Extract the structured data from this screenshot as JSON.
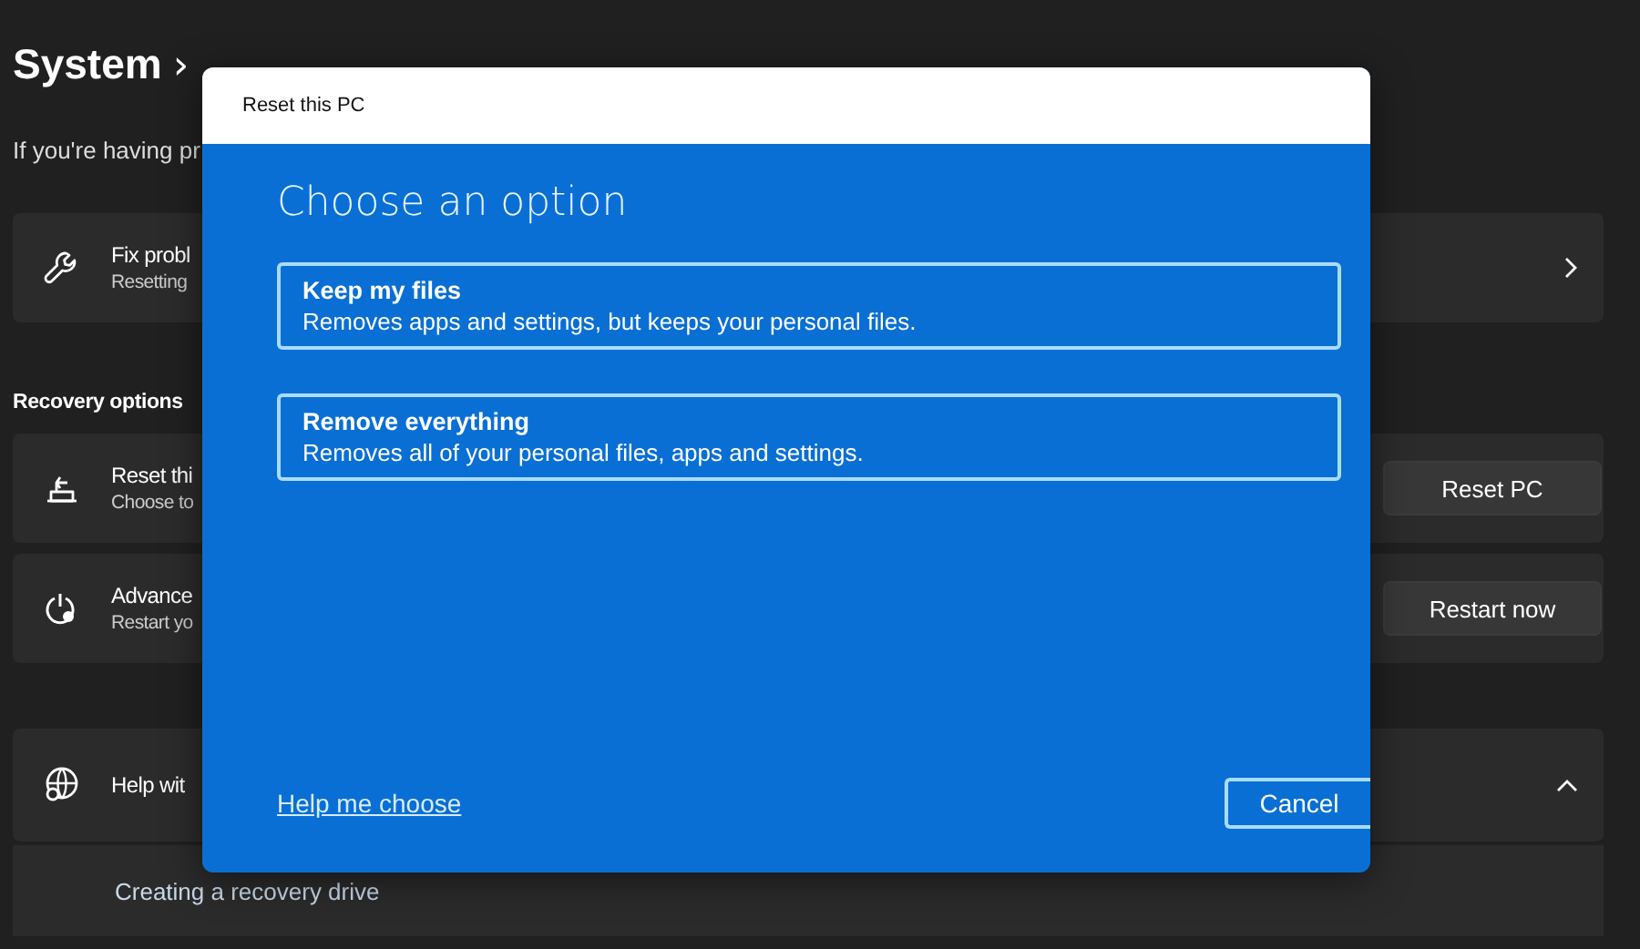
{
  "page": {
    "breadcrumb": [
      "System",
      "›"
    ],
    "intro": "If you're having pr",
    "cards": [
      {
        "kind": "link",
        "title": "Fix probl",
        "subtitle": "Resetting"
      },
      {
        "kind": "heading",
        "title": "Recovery options"
      },
      {
        "kind": "button",
        "title": "Reset thi",
        "subtitle": "Choose to",
        "button": "Reset PC"
      },
      {
        "kind": "button",
        "title": "Advance",
        "subtitle": "Restart yo",
        "button": "Restart now"
      },
      {
        "kind": "expander",
        "title": "Help wit",
        "expanded": true,
        "links": [
          "Creating a recovery drive"
        ]
      }
    ]
  },
  "dialog": {
    "title": "Reset this PC",
    "heading": "Choose an option",
    "options": [
      {
        "title": "Keep my files",
        "description": "Removes apps and settings, but keeps your personal files."
      },
      {
        "title": "Remove everything",
        "description": "Removes all of your personal files, apps and settings."
      }
    ],
    "help_link": "Help me choose",
    "cancel": "Cancel"
  }
}
